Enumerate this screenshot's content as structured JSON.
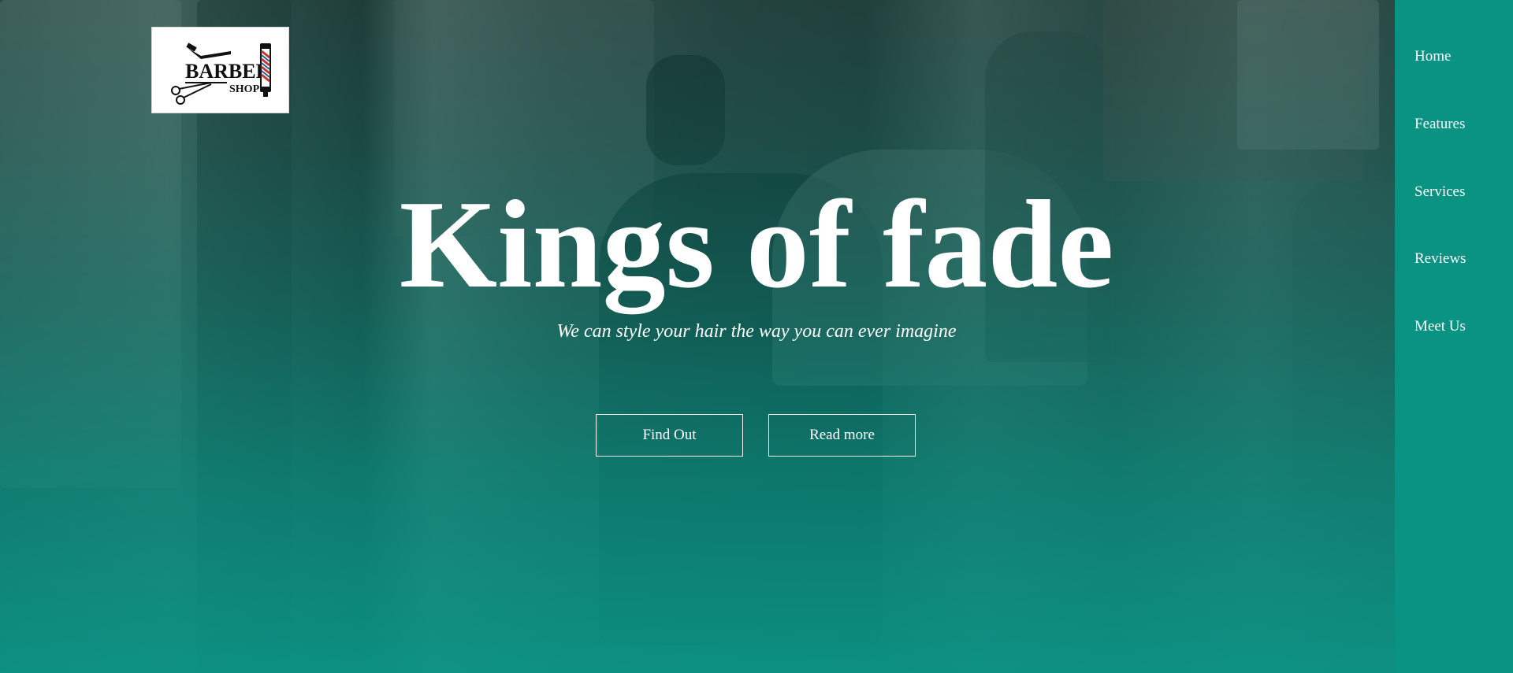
{
  "logo": {
    "line1": "BARBER",
    "line2": "SHOP",
    "icons": [
      "razor-icon",
      "scissors-icon",
      "barber-pole-icon"
    ]
  },
  "nav": {
    "items": [
      {
        "label": "Home"
      },
      {
        "label": "Features"
      },
      {
        "label": "Services"
      },
      {
        "label": "Reviews"
      },
      {
        "label": "Meet Us"
      }
    ]
  },
  "hero": {
    "title": "Kings of fade",
    "subtitle": "We can style your hair the way you can ever imagine",
    "buttons": [
      {
        "label": "Find Out"
      },
      {
        "label": "Read more"
      }
    ]
  },
  "colors": {
    "accent": "#0a9382",
    "overlay_top": "#085c52",
    "text": "#ffffff"
  }
}
